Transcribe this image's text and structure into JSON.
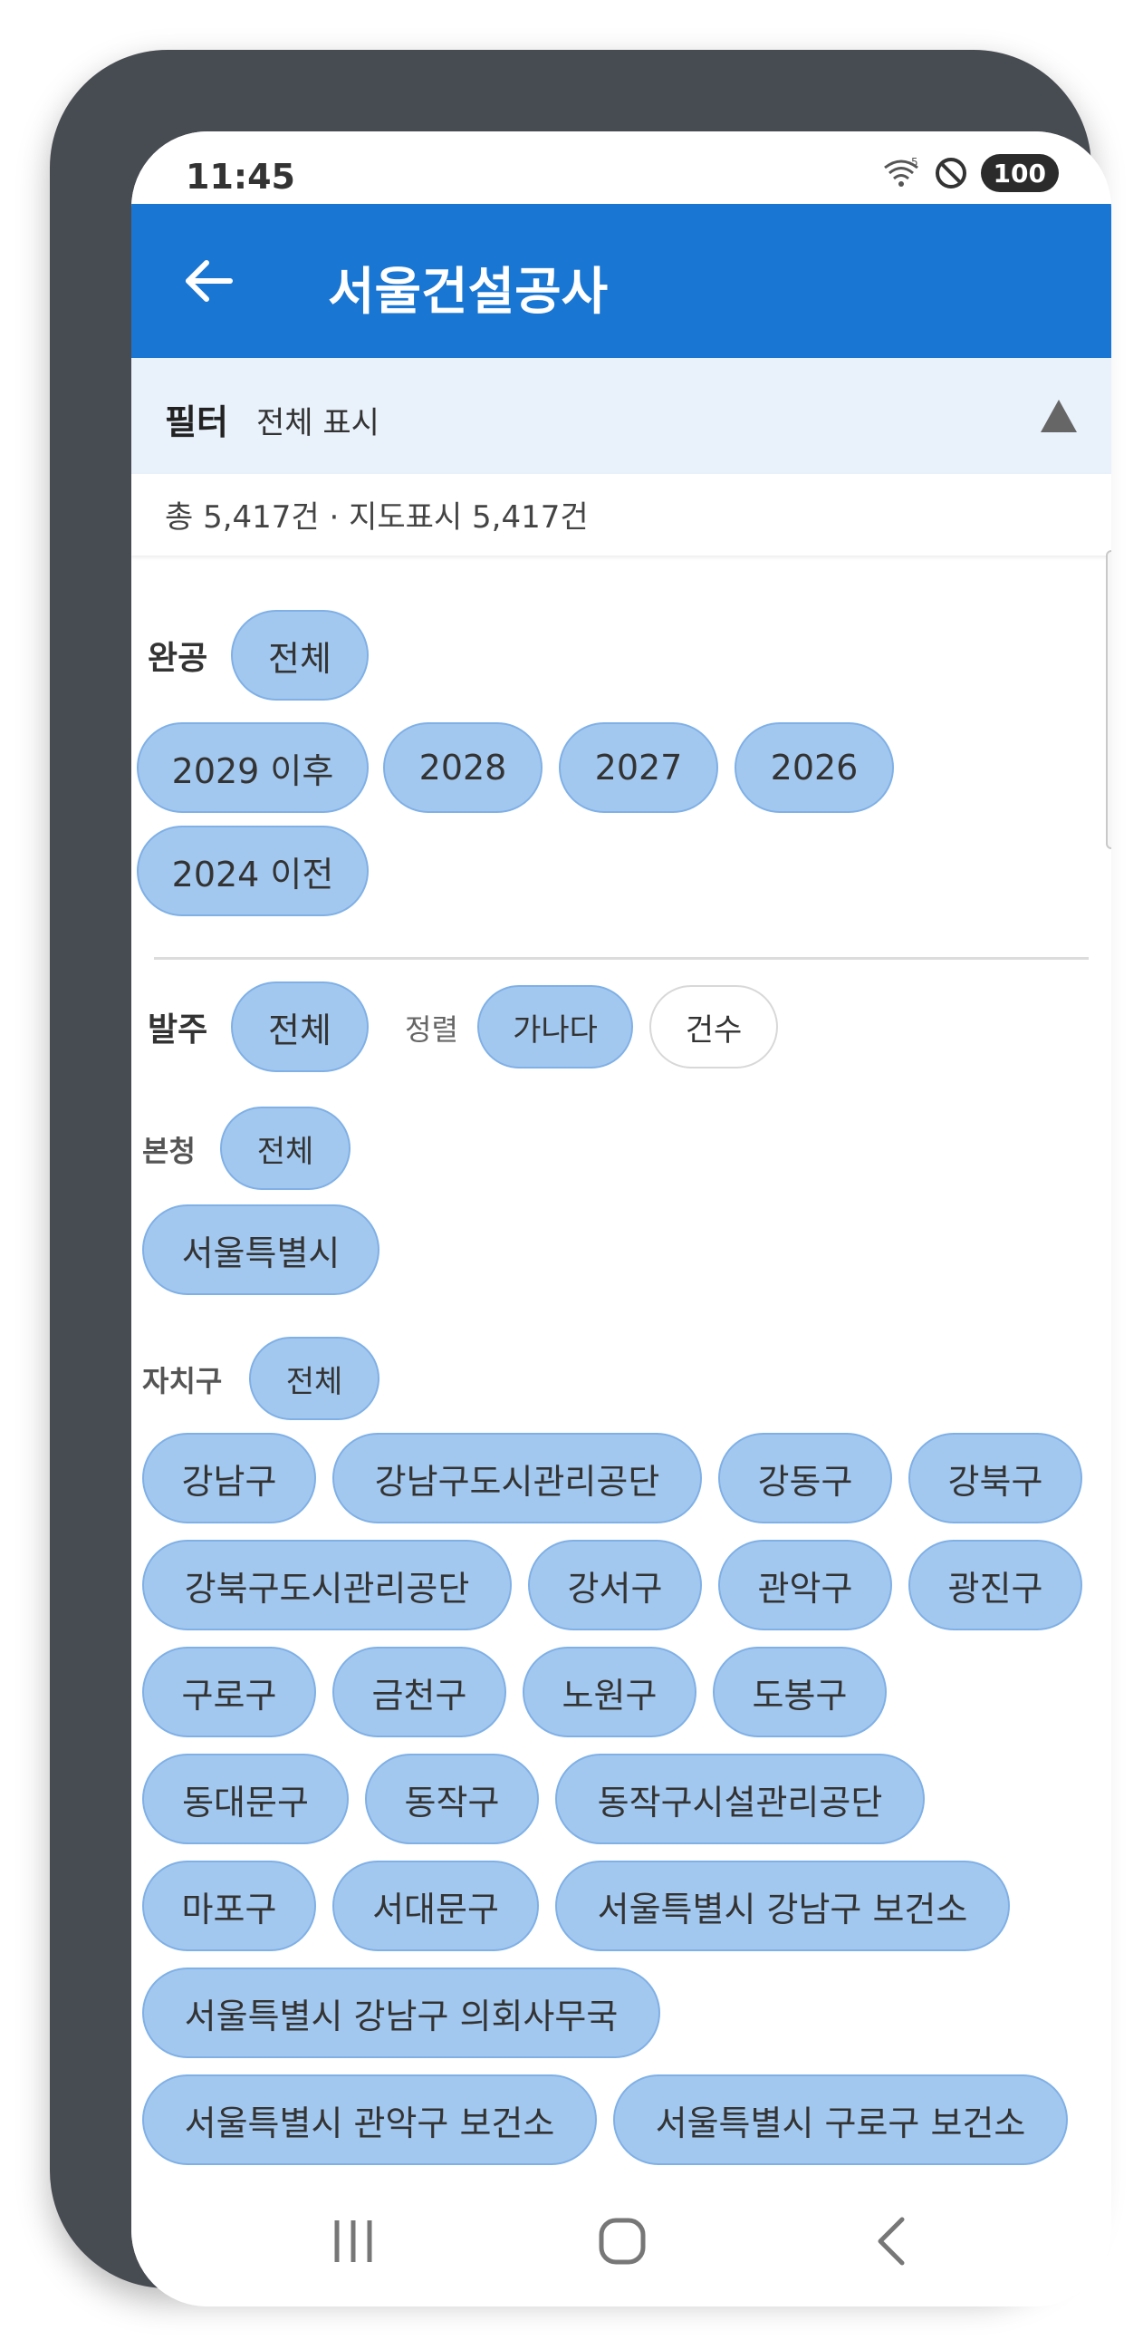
{
  "status": {
    "time": "11:45",
    "battery": "100",
    "wifi_badge": "5"
  },
  "appbar": {
    "title": "서울건설공사"
  },
  "filter": {
    "title": "필터",
    "summary": "전체 표시"
  },
  "counts": {
    "text": "총 5,417건 · 지도표시 5,417건"
  },
  "completion": {
    "label": "완공",
    "all": "전체",
    "years": [
      "2029 이후",
      "2028",
      "2027",
      "2026",
      "2024 이전"
    ]
  },
  "order": {
    "label": "발주",
    "all": "전체",
    "sort_label": "정렬",
    "sort_options": [
      "가나다",
      "건수"
    ],
    "hq_label": "본청",
    "hq_all": "전체",
    "hq_items": [
      "서울특별시"
    ],
    "district_label": "자치구",
    "district_all": "전체",
    "districts": [
      "강남구",
      "강남구도시관리공단",
      "강동구",
      "강북구",
      "강북구도시관리공단",
      "강서구",
      "관악구",
      "광진구",
      "구로구",
      "금천구",
      "노원구",
      "도봉구",
      "동대문구",
      "동작구",
      "동작구시설관리공단",
      "마포구",
      "서대문구",
      "서울특별시 강남구 보건소",
      "서울특별시 강남구 의회사무국",
      "서울특별시 관악구 보건소",
      "서울특별시 구로구 보건소"
    ]
  },
  "colors": {
    "primary": "#1976d2",
    "chip": "#a3c8ef",
    "filter_bg": "#e9f1fb"
  }
}
